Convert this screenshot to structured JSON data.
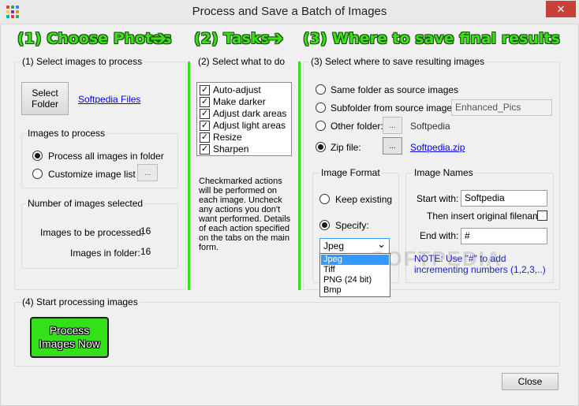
{
  "window": {
    "title": "Process and Save a Batch of Images",
    "close_glyph": "✕"
  },
  "banner": {
    "step1": "(1) Choose Photos",
    "step2": "(2) Tasks",
    "step3": "(3) Where to save final results",
    "arrow": "➔"
  },
  "select_images": {
    "legend": "(1) Select images to process",
    "select_folder_label": "Select\nFolder",
    "folder_link": "Softpedia Files",
    "images_group": {
      "legend": "Images to process",
      "option_all": "Process all images in folder",
      "option_customize": "Customize image list",
      "ellipsis": "..."
    },
    "count_group": {
      "legend": "Number of images selected",
      "to_process_label": "Images to be processed:",
      "to_process_value": "16",
      "in_folder_label": "Images in folder:",
      "in_folder_value": "16"
    }
  },
  "tasks": {
    "legend": "(2) Select what to do",
    "items": [
      {
        "label": "Auto-adjust",
        "checked": true
      },
      {
        "label": "Make darker",
        "checked": true
      },
      {
        "label": "Adjust dark areas",
        "checked": true
      },
      {
        "label": "Adjust light areas",
        "checked": true
      },
      {
        "label": "Resize",
        "checked": true
      },
      {
        "label": "Sharpen",
        "checked": true
      }
    ],
    "help": "Checkmarked actions will be performed on each image.  Uncheck any actions you don't want performed.  Details of each action specified on the tabs on the main form.",
    "check_glyph": "✓"
  },
  "save": {
    "legend": "(3) Select where to save resulting images",
    "opt_same": "Same folder as source images",
    "opt_subfolder": "Subfolder from source images:",
    "subfolder_value": "Enhanced_Pics",
    "opt_other": "Other folder:",
    "other_value": "Softpedia",
    "opt_zip": "Zip file:",
    "zip_link": "Softpedia.zip",
    "ellipsis": "...",
    "format_group": {
      "legend": "Image Format",
      "keep": "Keep existing",
      "specify": "Specify:",
      "selected": "Jpeg",
      "options": [
        "Jpeg",
        "Tiff",
        "PNG (24 bit)",
        "Bmp"
      ],
      "chevron": "⌄"
    },
    "names_group": {
      "legend": "Image Names",
      "start_label": "Start with:",
      "start_value": "Softpedia",
      "insert_label": "Then insert original filename",
      "end_label": "End with:",
      "end_value": "#",
      "note": "NOTE: Use \"#\" to add incrementing numbers (1,2,3,..)"
    }
  },
  "start": {
    "legend": "(4) Start processing images",
    "process_label": "Process\nImages Now"
  },
  "footer": {
    "close_label": "Close"
  },
  "watermark": "SOFTPEDIA",
  "colors": {
    "accent_green": "#33e01a",
    "link_blue": "#0000ee",
    "selection_blue": "#3399ff"
  }
}
